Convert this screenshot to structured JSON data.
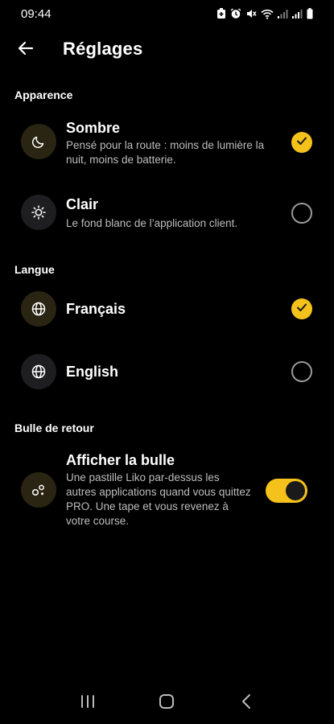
{
  "status_bar": {
    "time": "09:44",
    "icons": [
      "battery-saver-icon",
      "alarm-icon",
      "mute-icon",
      "wifi-icon",
      "signal-icon",
      "signal-icon",
      "battery-icon"
    ]
  },
  "header": {
    "back_icon": "arrow-left-icon",
    "title": "Réglages"
  },
  "sections": {
    "appearance": {
      "title": "Apparence",
      "options": [
        {
          "icon": "moon-icon",
          "label": "Sombre",
          "description": "Pensé pour la route : moins de lumière la nuit, moins de batterie.",
          "selected": true
        },
        {
          "icon": "sun-icon",
          "label": "Clair",
          "description": "Le fond blanc de l’application client.",
          "selected": false
        }
      ]
    },
    "language": {
      "title": "Langue",
      "options": [
        {
          "icon": "globe-icon",
          "label": "Français",
          "selected": true
        },
        {
          "icon": "globe-icon",
          "label": "English",
          "selected": false
        }
      ]
    },
    "bubble": {
      "title": "Bulle de retour",
      "option": {
        "icon": "bubble-icon",
        "label": "Afficher la bulle",
        "description": "Une pastille Liko par-dessus les autres applications quand vous quittez PRO. Une tape et vous revenez à votre course.",
        "enabled": true
      }
    }
  },
  "nav_bar": {
    "icons": [
      "recent-apps-icon",
      "home-icon",
      "back-icon"
    ]
  },
  "colors": {
    "accent": "#f5c21b",
    "background": "#000000",
    "secondary_text": "#bdbdbd"
  }
}
